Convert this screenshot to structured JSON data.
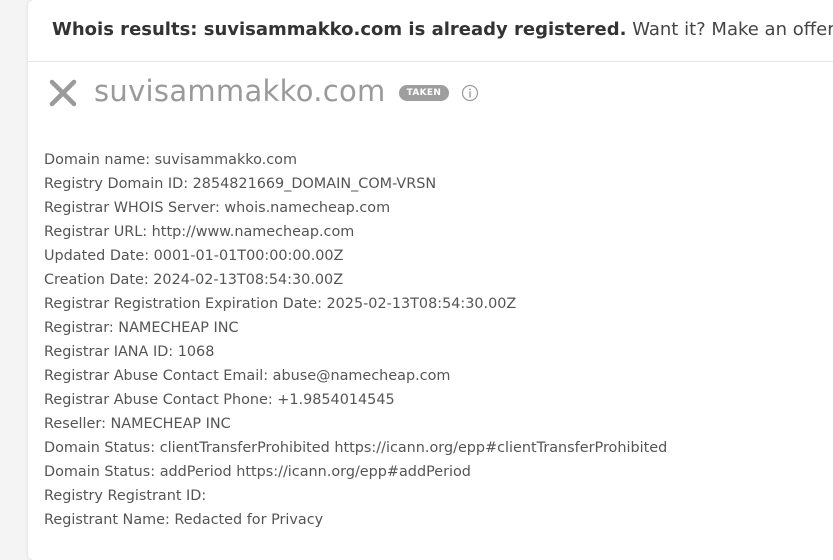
{
  "header": {
    "bold_text": "Whois results: suvisammakko.com is already registered.",
    "offer_text": "Want it? Make an offer now."
  },
  "domain": {
    "name": "suvisammakko.com",
    "badge": "TAKEN",
    "status_icon": "close-x-icon",
    "info_icon": "info-icon"
  },
  "whois_lines": [
    "Domain name: suvisammakko.com",
    "Registry Domain ID: 2854821669_DOMAIN_COM-VRSN",
    "Registrar WHOIS Server: whois.namecheap.com",
    "Registrar URL: http://www.namecheap.com",
    "Updated Date: 0001-01-01T00:00:00.00Z",
    "Creation Date: 2024-02-13T08:54:30.00Z",
    "Registrar Registration Expiration Date: 2025-02-13T08:54:30.00Z",
    "Registrar: NAMECHEAP INC",
    "Registrar IANA ID: 1068",
    "Registrar Abuse Contact Email: abuse@namecheap.com",
    "Registrar Abuse Contact Phone: +1.9854014545",
    "Reseller: NAMECHEAP INC",
    "Domain Status: clientTransferProhibited https://icann.org/epp#clientTransferProhibited",
    "Domain Status: addPeriod https://icann.org/epp#addPeriod",
    "Registry Registrant ID:",
    "Registrant Name: Redacted for Privacy"
  ],
  "colors": {
    "icon_gray": "#9a9a9a",
    "badge_bg": "#9e9e9e"
  }
}
